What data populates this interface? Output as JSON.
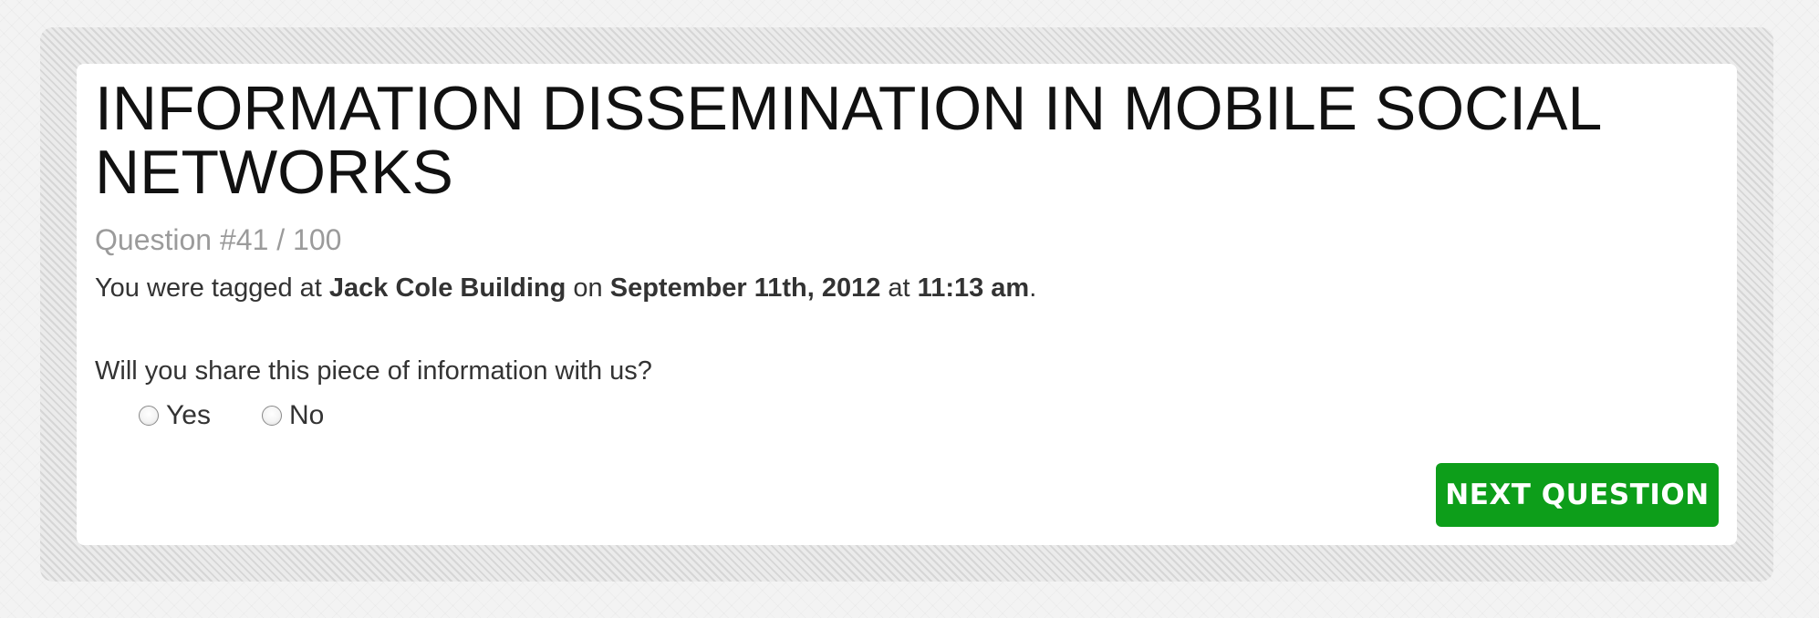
{
  "survey": {
    "title": "INFORMATION DISSEMINATION IN MOBILE SOCIAL NETWORKS",
    "question_number": "Question #41 / 100",
    "tag_sentence": {
      "prefix": "You were tagged at ",
      "location": "Jack Cole Building",
      "mid1": " on ",
      "date": "September 11th, 2012",
      "mid2": " at ",
      "time": "11:13 am",
      "suffix": "."
    },
    "prompt": "Will you share this piece of information with us?",
    "options": [
      {
        "label": "Yes",
        "selected": false
      },
      {
        "label": "No",
        "selected": false
      }
    ],
    "next_button_label": "NEXT QUESTION"
  },
  "colors": {
    "button_green": "#0d9e1a",
    "muted_text": "#9b9b9b",
    "body_text": "#333333",
    "title_text": "#111111"
  }
}
